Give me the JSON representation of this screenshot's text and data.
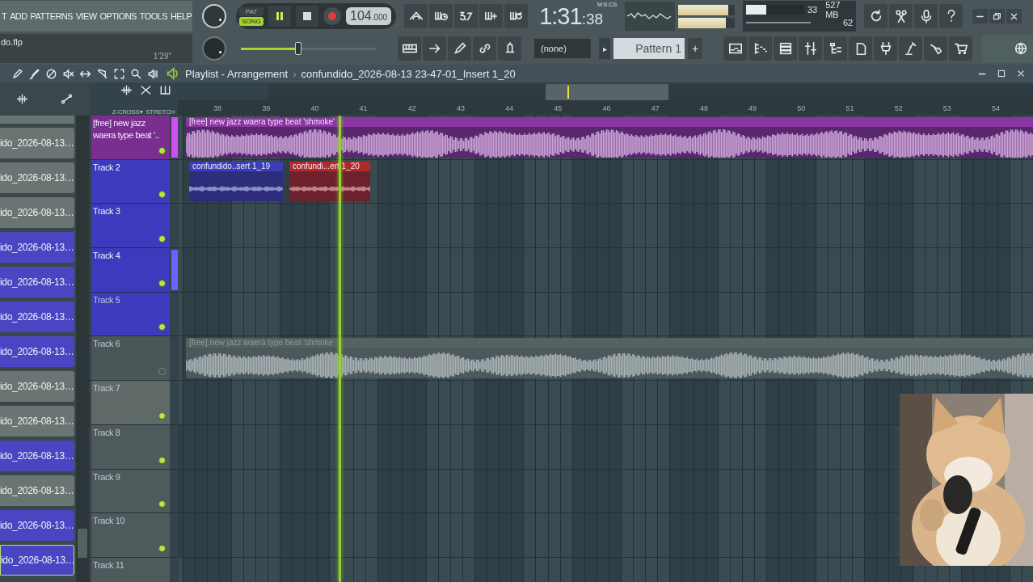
{
  "menu": [
    "T",
    "ADD",
    "PATTERNS",
    "VIEW",
    "OPTIONS",
    "TOOLS",
    "HELP"
  ],
  "project": {
    "file": "do.flp",
    "hint": "1'29\""
  },
  "transport": {
    "modes": [
      {
        "label": "PAT",
        "selected": false
      },
      {
        "label": "SONG",
        "selected": true
      }
    ],
    "playing": true
  },
  "tempo": {
    "whole": "104",
    "fraction": ".000"
  },
  "time": {
    "main": "1:31",
    "sub": ":38",
    "format": "M:S:CS"
  },
  "master_volume": {
    "level": 0.42
  },
  "meters": [
    {
      "level": 0.88
    },
    {
      "level": 0.84
    }
  ],
  "cpu": {
    "voices": "33",
    "memory": "527 MB",
    "polyphony": "62",
    "level": 0.35
  },
  "pattern": {
    "channel": "(none)",
    "arrow": "▸",
    "name": "Pattern 1",
    "add": "+"
  },
  "playlist": {
    "title": "Playlist - Arrangement",
    "separator": "›",
    "clip": "confundido_2026-08-13 23-47-01_Insert 1_20",
    "snap": [
      {
        "label": "Z-CROSS",
        "caret": "▾"
      },
      {
        "label": "STRETCH"
      }
    ]
  },
  "ruler": [
    "38",
    "39",
    "40",
    "41",
    "42",
    "43",
    "44",
    "45",
    "46",
    "47",
    "48",
    "49",
    "50",
    "51",
    "52",
    "53",
    "54"
  ],
  "playhead": {
    "level": 0.192
  },
  "browser": [
    {
      "name": "ido_2026-08-13…",
      "color": "#6a7472",
      "selected": false
    },
    {
      "name": "ido_2026-08-13…",
      "color": "#6a7472",
      "selected": false
    },
    {
      "name": "ido_2026-08-13…",
      "color": "#6a7472",
      "selected": false
    },
    {
      "name": "ido_2026-08-13…",
      "color": "#4a45c2",
      "selected": false
    },
    {
      "name": "ido_2026-08-13…",
      "color": "#4a45c2",
      "selected": false
    },
    {
      "name": "ido_2026-08-13…",
      "color": "#4a45c2",
      "selected": false
    },
    {
      "name": "ido_2026-08-13…",
      "color": "#4a45c2",
      "selected": false
    },
    {
      "name": "ido_2026-08-13…",
      "color": "#6a7472",
      "selected": false
    },
    {
      "name": "ido_2026-08-13…",
      "color": "#6a7472",
      "selected": false
    },
    {
      "name": "ido_2026-08-13…",
      "color": "#4a45c2",
      "selected": false
    },
    {
      "name": "ido_2026-08-13…",
      "color": "#6a7472",
      "selected": false
    },
    {
      "name": "ido_2026-08-13…",
      "color": "#4a45c2",
      "selected": false
    },
    {
      "name": "ido_2026-08-13…",
      "color": "#4a45c2",
      "selected": true
    }
  ],
  "tracks": [
    {
      "name": "[free] new jazz waera type beat '..",
      "color": "#7a2e90",
      "dimmed": false,
      "enabled": true,
      "selected": true,
      "clips": [
        {
          "label": "[free] new jazz  waera type beat  'shmoke'",
          "color": "#8a35a2",
          "muted": false
        }
      ]
    },
    {
      "name": "Track 2",
      "color": "#3d3bbd",
      "dimmed": false,
      "enabled": true,
      "selected": false,
      "clips": [
        {
          "label": "confundido..sert 1_19",
          "color": "#3a3fb8",
          "muted": false
        },
        {
          "label": "confundi...ert 1_20",
          "color": "#b02a2a",
          "muted": false
        }
      ]
    },
    {
      "name": "Track 3",
      "color": "#3d3bbd",
      "dimmed": false,
      "enabled": true,
      "selected": false
    },
    {
      "name": "Track 4",
      "color": "#3d3bbd",
      "dimmed": false,
      "enabled": true,
      "selected": true
    },
    {
      "name": "Track 5",
      "color": "#3d3bbd",
      "dimmed": true,
      "enabled": true,
      "selected": false
    },
    {
      "name": "Track 6",
      "color": "#4b5658",
      "dimmed": true,
      "enabled": false,
      "selected": false,
      "clips": [
        {
          "label": "[free] new jazz  waera type beat  'shmoke'",
          "color": "#5b6668",
          "muted": true
        }
      ]
    },
    {
      "name": "Track 7",
      "color": "#5f6967",
      "dimmed": true,
      "enabled": true,
      "selected": false
    },
    {
      "name": "Track 8",
      "color": "#4f5a5c",
      "dimmed": true,
      "enabled": true,
      "selected": false
    },
    {
      "name": "Track 9",
      "color": "#4f5a5c",
      "dimmed": true,
      "enabled": true,
      "selected": false
    },
    {
      "name": "Track 10",
      "color": "#4f5a5c",
      "dimmed": true,
      "enabled": true,
      "selected": false
    },
    {
      "name": "Track 11",
      "color": "#4f5a5c",
      "dimmed": true,
      "selected": false
    }
  ]
}
